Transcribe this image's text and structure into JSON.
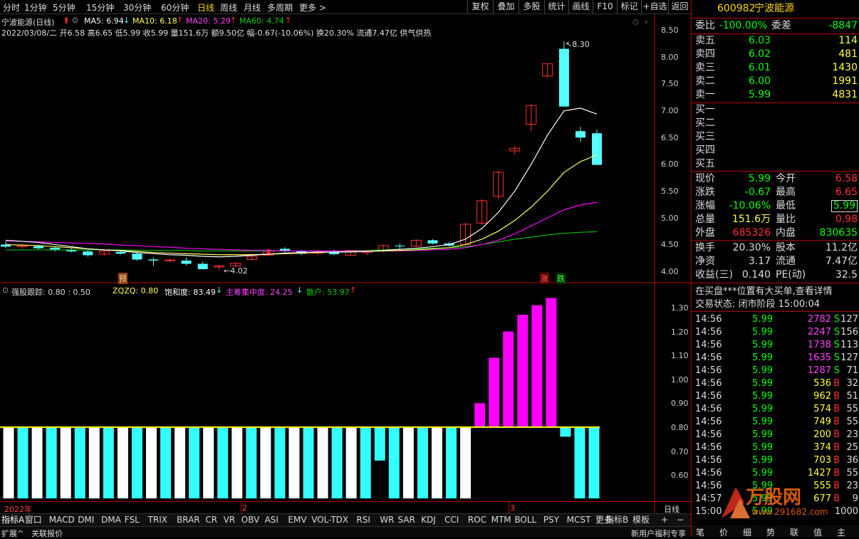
{
  "period_tabs": [
    "分时",
    "1分钟",
    "5分钟",
    "15分钟",
    "30分钟",
    "60分钟",
    "日线",
    "周线",
    "月线",
    "多周期",
    "更多 >"
  ],
  "active_period": "日线",
  "toolbar_buttons": [
    "复权",
    "叠加",
    "多股",
    "统计",
    "画线",
    "F10",
    "标记",
    "+自选",
    "返回"
  ],
  "header": {
    "stock_code": "600982",
    "stock_name": "宁波能源",
    "main_title": "宁波能源(日线)",
    "ma5": "MA5: 6.94",
    "ma10": "MA10: 6.18",
    "ma20": "MA20: 5.29",
    "ma60": "MA60: 4.74",
    "info_line": "2022/03/08/二 开6.58 高6.65 低5.99 收5.99 量151.6万 额9.50亿 幅-0.67(-10.06%) 换20.30% 流通7.47亿 供气供热"
  },
  "main_chart": {
    "y_ticks": [
      "8.50",
      "8.00",
      "7.50",
      "7.00",
      "6.50",
      "6.00",
      "5.50",
      "5.00",
      "4.50",
      "4.00"
    ],
    "y_range": [
      3.9,
      8.6
    ],
    "high_label": "8.30",
    "low_label": "4.02",
    "marks": [
      "预",
      "涨",
      "跌"
    ],
    "colors": {
      "up": "#ff3030",
      "down": "#54ffff",
      "ma5": "#ffffff",
      "ma10": "#ffff60",
      "ma20": "#ff00ff",
      "ma60": "#00c000"
    }
  },
  "chart_data": [
    {
      "type": "candlestick",
      "title": "宁波能源(日线)",
      "ohlc": [
        [
          4.5,
          4.56,
          4.44,
          4.46
        ],
        [
          4.46,
          4.52,
          4.42,
          4.48
        ],
        [
          4.47,
          4.5,
          4.41,
          4.43
        ],
        [
          4.44,
          4.47,
          4.37,
          4.4
        ],
        [
          4.4,
          4.43,
          4.35,
          4.37
        ],
        [
          4.37,
          4.4,
          4.27,
          4.3
        ],
        [
          4.32,
          4.41,
          4.29,
          4.38
        ],
        [
          4.36,
          4.39,
          4.31,
          4.33
        ],
        [
          4.33,
          4.37,
          4.2,
          4.22
        ],
        [
          4.22,
          4.26,
          4.1,
          4.2
        ],
        [
          4.2,
          4.24,
          4.17,
          4.21
        ],
        [
          4.2,
          4.26,
          4.11,
          4.14
        ],
        [
          4.14,
          4.18,
          4.04,
          4.04
        ],
        [
          4.08,
          4.12,
          4.02,
          4.1
        ],
        [
          4.1,
          4.16,
          4.08,
          4.15
        ],
        [
          4.22,
          4.32,
          4.2,
          4.28
        ],
        [
          4.3,
          4.42,
          4.3,
          4.38
        ],
        [
          4.42,
          4.45,
          4.35,
          4.38
        ],
        [
          4.38,
          4.4,
          4.3,
          4.33
        ],
        [
          4.34,
          4.4,
          4.3,
          4.36
        ],
        [
          4.36,
          4.4,
          4.3,
          4.32
        ],
        [
          4.3,
          4.4,
          4.3,
          4.39
        ],
        [
          4.35,
          4.4,
          4.3,
          4.38
        ],
        [
          4.4,
          4.5,
          4.35,
          4.48
        ],
        [
          4.48,
          4.52,
          4.42,
          4.47
        ],
        [
          4.47,
          4.6,
          4.45,
          4.58
        ],
        [
          4.58,
          4.6,
          4.5,
          4.52
        ],
        [
          4.52,
          4.55,
          4.46,
          4.48
        ],
        [
          4.5,
          4.9,
          4.48,
          4.88
        ],
        [
          4.9,
          5.35,
          4.88,
          5.32
        ],
        [
          5.4,
          5.88,
          5.35,
          5.85
        ],
        [
          6.25,
          6.35,
          6.18,
          6.3
        ],
        [
          6.75,
          7.12,
          6.62,
          7.1
        ],
        [
          7.65,
          7.88,
          7.62,
          7.88
        ],
        [
          8.16,
          8.3,
          7.08,
          7.08
        ],
        [
          6.62,
          6.7,
          6.42,
          6.5
        ],
        [
          6.58,
          6.65,
          5.99,
          5.99
        ]
      ],
      "ma5": [
        4.58,
        4.56,
        4.54,
        4.5,
        4.46,
        4.42,
        4.4,
        4.38,
        4.35,
        4.33,
        4.31,
        4.3,
        4.28,
        4.27,
        4.28,
        4.3,
        4.32,
        4.34,
        4.35,
        4.36,
        4.36,
        4.37,
        4.37,
        4.39,
        4.41,
        4.43,
        4.46,
        4.5,
        4.6,
        4.8,
        5.1,
        5.5,
        6.0,
        6.55,
        7.0,
        7.05,
        6.94
      ],
      "ma10": [
        4.5,
        4.49,
        4.48,
        4.46,
        4.44,
        4.42,
        4.4,
        4.39,
        4.37,
        4.35,
        4.34,
        4.33,
        4.32,
        4.31,
        4.31,
        4.31,
        4.32,
        4.33,
        4.34,
        4.35,
        4.36,
        4.36,
        4.37,
        4.38,
        4.39,
        4.4,
        4.42,
        4.44,
        4.5,
        4.6,
        4.75,
        4.95,
        5.2,
        5.5,
        5.85,
        6.05,
        6.18
      ],
      "ma20": [
        4.57,
        4.56,
        4.55,
        4.54,
        4.53,
        4.52,
        4.51,
        4.49,
        4.48,
        4.46,
        4.45,
        4.43,
        4.42,
        4.41,
        4.4,
        4.39,
        4.39,
        4.38,
        4.38,
        4.38,
        4.38,
        4.38,
        4.38,
        4.38,
        4.38,
        4.39,
        4.4,
        4.41,
        4.44,
        4.5,
        4.58,
        4.7,
        4.85,
        5.0,
        5.15,
        5.24,
        5.29
      ],
      "ma60": [
        4.4,
        4.4,
        4.4,
        4.4,
        4.4,
        4.4,
        4.4,
        4.4,
        4.39,
        4.39,
        4.39,
        4.39,
        4.38,
        4.38,
        4.38,
        4.38,
        4.38,
        4.38,
        4.38,
        4.38,
        4.38,
        4.38,
        4.39,
        4.4,
        4.41,
        4.42,
        4.43,
        4.44,
        4.46,
        4.5,
        4.55,
        4.6,
        4.64,
        4.68,
        4.71,
        4.73,
        4.74
      ],
      "ylim": [
        3.9,
        8.6
      ]
    },
    {
      "type": "bar",
      "title": "强股跟踪",
      "values": [
        0.53,
        0.53,
        0.53,
        0.53,
        0.53,
        0.53,
        0.53,
        0.53,
        0.53,
        0.53,
        0.53,
        0.53,
        0.53,
        0.53,
        0.53,
        0.53,
        0.53,
        0.53,
        0.53,
        0.53,
        0.53,
        0.53,
        0.53,
        0.53,
        0.53,
        0.55,
        0.66,
        0.54,
        0.53,
        0.53,
        0.53,
        0.53,
        0.53,
        0.9,
        1.09,
        1.2,
        1.27,
        1.31,
        1.34,
        0.76,
        0.53,
        0.53
      ],
      "baseline": 0.8,
      "ylim": [
        0.52,
        1.38
      ]
    }
  ],
  "indicator": {
    "title": "强股跟踪",
    "params": ": 0.80 : 0.50",
    "zqzq": "ZQZQ: 0.80",
    "saturation": "饱和度: 83.49",
    "main_concentration": "主筹集中度: 24.25",
    "retail": "散户: 53.97",
    "y_ticks": [
      "1.30",
      "1.20",
      "1.10",
      "1.00",
      "0.90",
      "0.80",
      "0.70",
      "0.60"
    ]
  },
  "x_axis": {
    "year_label": "2022年",
    "month_2": "2",
    "month_3": "3"
  },
  "bottom_tabs": [
    "指标A",
    "窗口",
    "MACD",
    "DMI",
    "DMA",
    "FSL",
    "TRIX",
    "BRAR",
    "CR",
    "VR",
    "OBV",
    "ASI",
    "EMV",
    "VOL-TDX",
    "RSI",
    "WR",
    "SAR",
    "KDJ",
    "CCI",
    "ROC",
    "MTM",
    "BOLL",
    "PSY",
    "MCST",
    "更多"
  ],
  "bottom_right_tabs": [
    "指标B",
    "模板"
  ],
  "bottom_bar": {
    "left1": "扩展^",
    "left2": "关联报价",
    "right_text": "新用户福利专享",
    "period": "日线"
  },
  "order_book": {
    "weibi_label": "委比",
    "weibi_value": "-100.00%",
    "weicha_label": "委差",
    "weicha_value": "-8847",
    "asks": [
      {
        "label": "卖五",
        "price": "6.03",
        "vol": "114"
      },
      {
        "label": "卖四",
        "price": "6.02",
        "vol": "481"
      },
      {
        "label": "卖三",
        "price": "6.01",
        "vol": "1430"
      },
      {
        "label": "卖二",
        "price": "6.00",
        "vol": "1991"
      },
      {
        "label": "卖一",
        "price": "5.99",
        "vol": "4831"
      }
    ],
    "bids": [
      {
        "label": "买一",
        "price": "",
        "vol": ""
      },
      {
        "label": "买二",
        "price": "",
        "vol": ""
      },
      {
        "label": "买三",
        "price": "",
        "vol": ""
      },
      {
        "label": "买四",
        "price": "",
        "vol": ""
      },
      {
        "label": "买五",
        "price": "",
        "vol": ""
      }
    ]
  },
  "quote": [
    {
      "l1": "现价",
      "v1": "5.99",
      "l2": "今开",
      "v2": "6.58"
    },
    {
      "l1": "涨跌",
      "v1": "-0.67",
      "l2": "最高",
      "v2": "6.65"
    },
    {
      "l1": "涨幅",
      "v1": "-10.06%",
      "l2": "最低",
      "v2": "5.99"
    },
    {
      "l1": "总量",
      "v1": "151.6万",
      "l2": "量比",
      "v2": "0.98"
    },
    {
      "l1": "外盘",
      "v1": "685326",
      "l2": "内盘",
      "v2": "830635"
    },
    {
      "l1": "换手",
      "v1": "20.30%",
      "l2": "股本",
      "v2": "11.2亿"
    },
    {
      "l1": "净资",
      "v1": "3.17",
      "l2": "流通",
      "v2": "7.47亿"
    },
    {
      "l1": "收益(三)",
      "v1": "0.140",
      "l2": "PE(动)",
      "v2": "32.5"
    }
  ],
  "notice": "在买盘***位置有大买单,查看详情",
  "trade_status": "交易状态: 闭市阶段 15:00:04",
  "ticks": [
    {
      "t": "14:56",
      "p": "5.99",
      "v": "2782",
      "d": "S",
      "n": "127"
    },
    {
      "t": "14:56",
      "p": "5.99",
      "v": "2247",
      "d": "S",
      "n": "156"
    },
    {
      "t": "14:56",
      "p": "5.99",
      "v": "1738",
      "d": "S",
      "n": "113"
    },
    {
      "t": "14:56",
      "p": "5.99",
      "v": "1635",
      "d": "S",
      "n": "127"
    },
    {
      "t": "14:56",
      "p": "5.99",
      "v": "1287",
      "d": "S",
      "n": "71"
    },
    {
      "t": "14:56",
      "p": "5.99",
      "v": "536",
      "d": "B",
      "n": "32"
    },
    {
      "t": "14:56",
      "p": "5.99",
      "v": "962",
      "d": "B",
      "n": "51"
    },
    {
      "t": "14:56",
      "p": "5.99",
      "v": "574",
      "d": "B",
      "n": "55"
    },
    {
      "t": "14:56",
      "p": "5.99",
      "v": "749",
      "d": "B",
      "n": "55"
    },
    {
      "t": "14:56",
      "p": "5.99",
      "v": "200",
      "d": "B",
      "n": "23"
    },
    {
      "t": "14:56",
      "p": "5.99",
      "v": "374",
      "d": "B",
      "n": "25"
    },
    {
      "t": "14:56",
      "p": "5.99",
      "v": "703",
      "d": "B",
      "n": "36"
    },
    {
      "t": "14:56",
      "p": "5.99",
      "v": "1427",
      "d": "B",
      "n": "55"
    },
    {
      "t": "14:56",
      "p": "5.99",
      "v": "555",
      "d": "B",
      "n": "23"
    },
    {
      "t": "14:57",
      "p": "5.99",
      "v": "677",
      "d": "B",
      "n": "9"
    },
    {
      "t": "15:00",
      "p": "5.99",
      "v": "",
      "d": "",
      "n": "1000"
    }
  ],
  "right_bottom_tabs": [
    "笔",
    "价",
    "细",
    "势",
    "联",
    "值",
    "主"
  ],
  "watermark": "万股网 www.291682.com"
}
